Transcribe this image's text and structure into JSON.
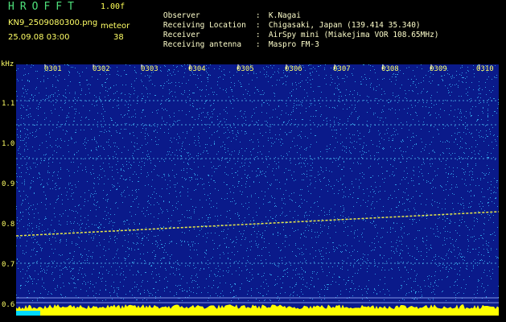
{
  "header": {
    "app_title": "HROFFT",
    "version": "1.00f",
    "filename": "KN9_2509080300.png",
    "mode": "meteor",
    "datetime": "25.09.08 03:00",
    "count": "38",
    "info": [
      {
        "key": "Observer",
        "value": "K.Nagai"
      },
      {
        "key": "Receiving Location",
        "value": "Chigasaki, Japan (139.414 35.340)"
      },
      {
        "key": "Receiver",
        "value": "AirSpy mini (Miakejima VOR 108.65MHz)"
      },
      {
        "key": "Receiving antenna",
        "value": "Maspro FM-3"
      }
    ]
  },
  "axis": {
    "y_unit": "kHz",
    "y_ticks": [
      "1.1",
      "1.0",
      "0.9",
      "0.8",
      "0.7",
      "0.6"
    ],
    "time_ticks": [
      "0301",
      "0302",
      "0303",
      "0304",
      "0305",
      "0306",
      "0307",
      "0308",
      "0309",
      "0310"
    ]
  },
  "colors": {
    "background": "#0a1a8a",
    "noise": "#3fc6ff",
    "signal": "#ffff40",
    "bottom_band": "#ffff00",
    "label": "#ffff66"
  }
}
